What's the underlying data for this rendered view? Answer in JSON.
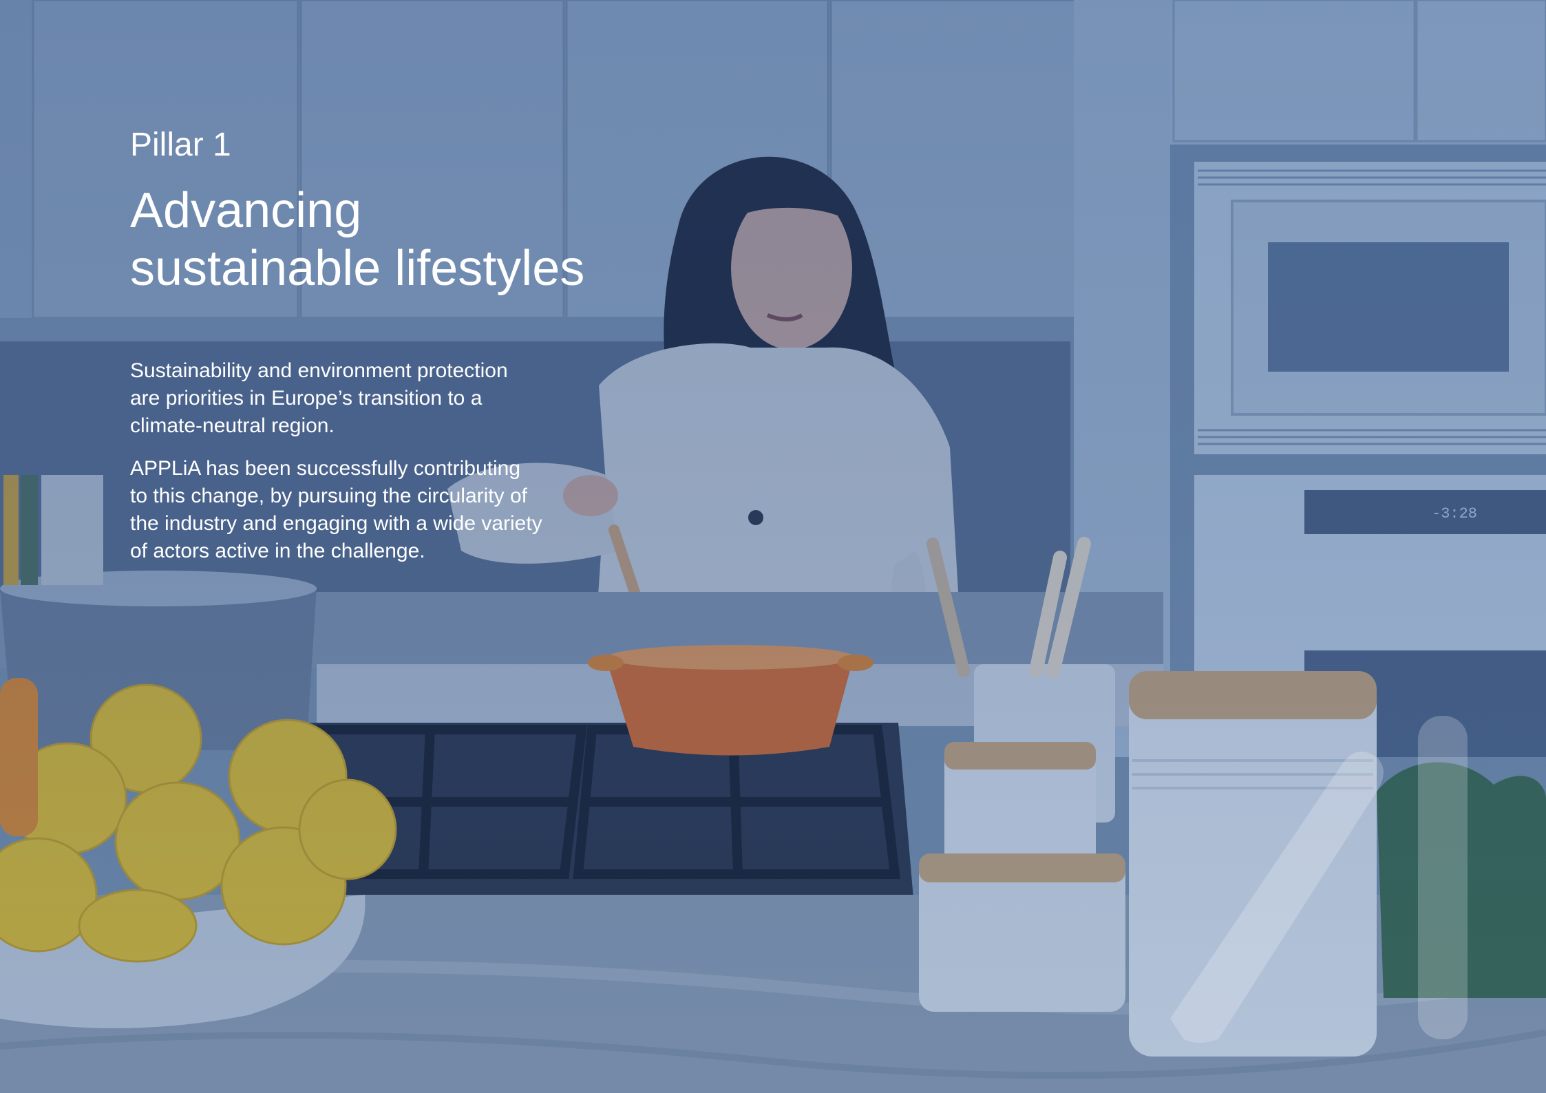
{
  "page": {
    "kicker": "Pillar 1",
    "headline_line1": "Advancing",
    "headline_line2": "sustainable lifestyles",
    "paragraphs": [
      "Sustainability and environment protection are priorities in Europe’s transition to a climate-neutral region.",
      "APPLiA has been successfully contributing to this change, by pursuing the circularity of the industry and engaging with a wide variety of actors active in the challenge."
    ],
    "oven_display": "-3:28"
  },
  "colors": {
    "overlay": "#2c4f8f",
    "text": "#ffffff",
    "pot": "#e2782c",
    "lemon": "#e8c62a"
  },
  "icons": {
    "watermark": "applia-mark-icon"
  }
}
